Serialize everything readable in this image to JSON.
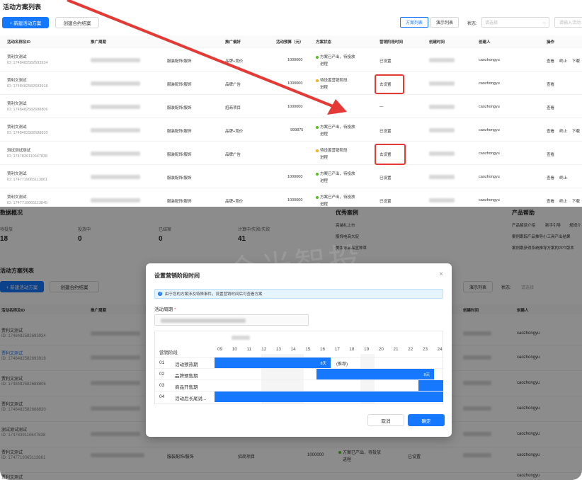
{
  "top": {
    "title": "活动方案列表",
    "new_button": "+ 新建活动方案",
    "template_button": "创建合约结案",
    "tab_scheme": "方案列表",
    "tab_demo": "演示列表",
    "status_label": "状态:",
    "status_placeholder": "请选择",
    "search_placeholder": "请输入活动",
    "columns": [
      "活动名称及ID",
      "推广周期",
      "推广偏好",
      "活动预算（元）",
      "方案状态",
      "营销阶段时间",
      "创建时间",
      "创建人",
      "操作"
    ],
    "rows": [
      {
        "name": "贾利文测试",
        "id": "ID: 1748482582693934",
        "industry": "服装配饰/服饰",
        "pref": "品牌+竞价",
        "budget": "1000000",
        "status": "方案已产出，待投放",
        "status_link": "进程",
        "stage": "已设置",
        "creator": "caozhongyu",
        "op1": "查看",
        "op2": "终止",
        "op3": "下载"
      },
      {
        "name": "贾利文测试",
        "id": "ID: 1748482582693918",
        "industry": "服装配饰/服饰",
        "pref": "品牌广告",
        "budget": "1000000",
        "status": "待设置营销阶段",
        "status_link": "进程",
        "stage": "去设置",
        "creator": "caozhongyu",
        "op1": "查看",
        "op2": "",
        "op3": ""
      },
      {
        "name": "贾利文测试",
        "id": "ID: 1748482582688806",
        "industry": "服装配饰/服饰",
        "pref": "招商项目",
        "budget": "1000000",
        "status": "",
        "status_link": "",
        "stage": "—",
        "creator": "caozhongyu",
        "op1": "查看",
        "op2": "",
        "op3": ""
      },
      {
        "name": "贾利文测试",
        "id": "ID: 1748482582688830",
        "industry": "服装配饰/服饰",
        "pref": "品牌+竞价",
        "budget": "999875",
        "status": "方案已产出，待投放",
        "status_link": "进程",
        "stage": "已设置",
        "creator": "caozhongyu",
        "op1": "查看",
        "op2": "终止",
        "op3": "下载"
      },
      {
        "name": "测试测试测试",
        "id": "ID: 1747839110647838",
        "industry": "服装配饰/服饰",
        "pref": "品牌广告",
        "budget": "",
        "status": "待设置营销阶段",
        "status_link": "进程",
        "stage": "去设置",
        "creator": "caozhongyu",
        "op1": "查看",
        "op2": "",
        "op3": ""
      },
      {
        "name": "贾利文测试",
        "id": "ID: 1747719065113861",
        "industry": "服装配饰/服饰",
        "pref": "",
        "budget": "1000000",
        "status": "方案已产出，待投放",
        "status_link": "进程",
        "stage": "已设置",
        "creator": "caozhongyu",
        "op1": "查看",
        "op2": "终止",
        "op3": ""
      },
      {
        "name": "贾利文测试",
        "id": "ID: 1747719065113845",
        "industry": "服装配饰/服饰",
        "pref": "品牌+竞价",
        "budget": "1000000",
        "status": "方案已产出，待投放",
        "status_link": "进程",
        "stage": "已设置",
        "creator": "caozhongyu",
        "op1": "查看",
        "op2": "终止",
        "op3": "下载"
      }
    ]
  },
  "bottom": {
    "overview_title": "数据概况",
    "stats": [
      {
        "label": "待投放",
        "value": "18"
      },
      {
        "label": "投放中",
        "value": "0"
      },
      {
        "label": "已结案",
        "value": "0"
      },
      {
        "label": "计算中/失败/失败",
        "value": "41"
      }
    ],
    "cases_title": "优秀案例",
    "cases": [
      "高端礼上市",
      "服饰电商大促",
      "美妆等品品宣种草"
    ],
    "help_title": "产品帮助",
    "help_items": [
      "产品解读介绍",
      "新手引导",
      "规规介",
      "案例跟踪产品推导小工具产出结果",
      "案例跟获得系统推导方案的PPT版本"
    ],
    "list_title": "活动方案列表",
    "new_button": "+ 新建活动方案",
    "template_button": "创建合约结案",
    "tab_demo": "演示列表",
    "status_label": "状态:",
    "status_placeholder": "请选择",
    "columns": [
      "活动名称及ID",
      "推广周期",
      "创建时间",
      "创建人"
    ],
    "rows": [
      {
        "name": "贾利文测试",
        "id": "ID: 1748482582693934",
        "creator": "caozhongyu"
      },
      {
        "name": "贾利文测试",
        "id": "ID: 1748482582693918",
        "creator": "caozhongyu"
      },
      {
        "name": "贾利文测试",
        "id": "ID: 1748482582688806",
        "creator": "caozhongyu"
      },
      {
        "name": "贾利文测试",
        "id": "ID: 1748482582688830",
        "creator": "caozhongyu"
      },
      {
        "name": "测试测试测试",
        "id": "ID: 1747839110647838",
        "creator": "caozhongyu"
      },
      {
        "name": "贾利文测试",
        "id": "ID: 1747719065113861",
        "industry": "服装配饰/服饰",
        "pref": "招商项目",
        "budget": "1000000",
        "status": "方案已产出，待投放",
        "status_link": "进程",
        "stage": "已设置",
        "creator": "caozhongyu"
      },
      {
        "name": "贾利文测试",
        "id": "",
        "creator": "caozhongyu"
      }
    ]
  },
  "modal": {
    "title": "设置营销阶段时间",
    "close": "×",
    "info": "由于您的方案涉及特殊事件，设置营销时间后可查看方案",
    "period_label": "活动周期",
    "required_mark": "*",
    "stage_header": "营销阶段",
    "days": [
      "09",
      "10",
      "11",
      "12",
      "13",
      "14",
      "15",
      "16",
      "17",
      "18",
      "19",
      "20",
      "21",
      "22",
      "23",
      "24"
    ],
    "stages": [
      {
        "no": "01",
        "name": "活动预热期",
        "bar_label": "8天",
        "extra": "(推荐)"
      },
      {
        "no": "02",
        "name": "品牌预售期",
        "bar_label": "8天",
        "extra": ""
      },
      {
        "no": "03",
        "name": "商品开售期",
        "bar_label": "",
        "extra": ""
      },
      {
        "no": "04",
        "name": "活动后长尾说...",
        "bar_label": "",
        "extra": ""
      }
    ],
    "cancel": "取消",
    "confirm": "确定"
  },
  "watermark": "合光智投",
  "colors": {
    "primary": "#1677ff",
    "highlight": "#e53935",
    "success": "#52c41a",
    "warning": "#faad14"
  }
}
